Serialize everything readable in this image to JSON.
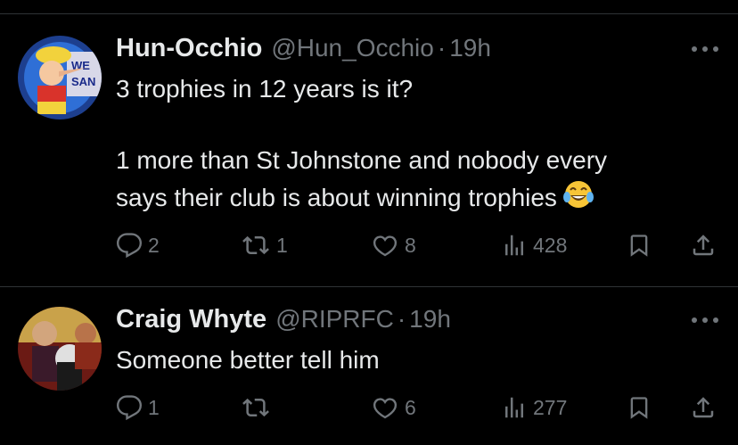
{
  "tweets": [
    {
      "display_name": "Hun-Occhio",
      "handle": "@Hun_Occhio",
      "separator": "·",
      "time": "19h",
      "text_lines": [
        "3 trophies in 12 years is it?",
        "",
        "1 more than St Johnstone and nobody every",
        "says their club is about winning trophies"
      ],
      "emoji": "face-with-tears-of-joy",
      "avatar_text": [
        "WE",
        "SAN"
      ],
      "replies": "2",
      "retweets": "1",
      "likes": "8",
      "views": "428"
    },
    {
      "display_name": "Craig Whyte",
      "handle": "@RIPRFC",
      "separator": "·",
      "time": "19h",
      "text_lines": [
        "Someone better tell him"
      ],
      "replies": "1",
      "retweets": "",
      "likes": "6",
      "views": "277"
    }
  ],
  "icons": {
    "reply": "reply-icon",
    "retweet": "retweet-icon",
    "like": "heart-icon",
    "views": "views-icon",
    "bookmark": "bookmark-icon",
    "share": "share-icon",
    "more": "more-icon"
  },
  "colors": {
    "background": "#000000",
    "text": "#e7e9ea",
    "muted": "#71767b",
    "divider": "#2f3336"
  }
}
